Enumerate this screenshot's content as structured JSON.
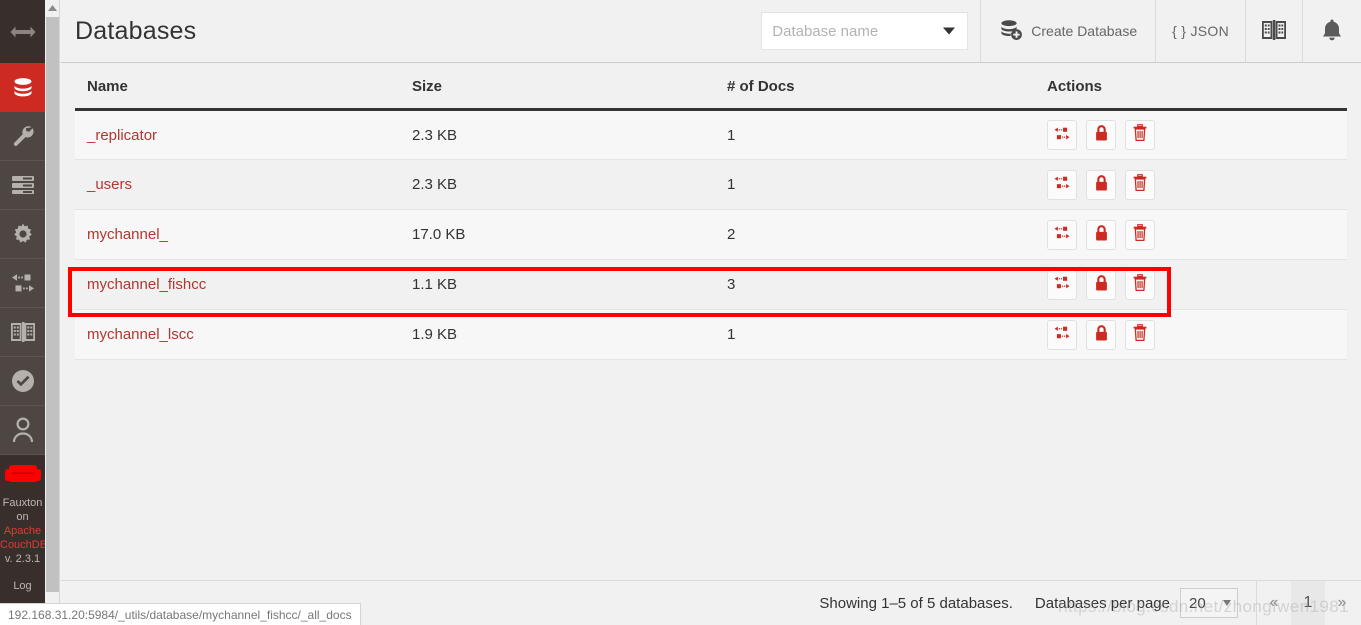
{
  "sidebar": {
    "items": [
      {
        "name": "toggle-sidebar",
        "icon": "double-arrow-icon",
        "active": false,
        "top": true
      },
      {
        "name": "databases",
        "icon": "database-icon",
        "active": true,
        "top": false
      },
      {
        "name": "setup",
        "icon": "wrench-icon",
        "active": false,
        "top": false
      },
      {
        "name": "active-tasks",
        "icon": "tasks-list-icon",
        "active": false,
        "top": false
      },
      {
        "name": "configuration",
        "icon": "gear-icon",
        "active": false,
        "top": false
      },
      {
        "name": "replication",
        "icon": "replication-arrows-icon",
        "active": false,
        "top": false
      },
      {
        "name": "documentation",
        "icon": "book-icon",
        "active": false,
        "top": false
      },
      {
        "name": "verify",
        "icon": "check-circle-icon",
        "active": false,
        "top": false
      },
      {
        "name": "user",
        "icon": "user-icon",
        "active": false,
        "top": false
      }
    ],
    "brand": {
      "logo": "couch-logo",
      "line1": "Fauxton",
      "line2": "on",
      "line3": "Apache",
      "line4": "CouchDB",
      "line5": "v. 2.3.1",
      "log_label": "Log"
    }
  },
  "header": {
    "title": "Databases",
    "db_select": {
      "placeholder": "Database name",
      "value": "",
      "caret_icon": "chevron-down-icon"
    },
    "create_button": {
      "label": "Create Database",
      "icon": "database-add-icon"
    },
    "json_button": {
      "label": "{ } JSON"
    },
    "docs_button": {
      "icon": "book-open-icon"
    },
    "notifications_button": {
      "icon": "bell-icon"
    }
  },
  "table": {
    "columns": [
      "Name",
      "Size",
      "# of Docs",
      "Actions"
    ],
    "action_icons": [
      "replicate-icon",
      "lock-icon",
      "trash-icon"
    ],
    "rows": [
      {
        "name": "_replicator",
        "size": "2.3 KB",
        "docs": "1",
        "highlighted": false
      },
      {
        "name": "_users",
        "size": "2.3 KB",
        "docs": "1",
        "highlighted": false
      },
      {
        "name": "mychannel_",
        "size": "17.0 KB",
        "docs": "2",
        "highlighted": false
      },
      {
        "name": "mychannel_fishcc",
        "size": "1.1 KB",
        "docs": "3",
        "highlighted": true
      },
      {
        "name": "mychannel_lscc",
        "size": "1.9 KB",
        "docs": "1",
        "highlighted": false
      }
    ]
  },
  "footer": {
    "showing": "Showing 1–5 of 5 databases.",
    "per_page_label": "Databases per page",
    "per_page_value": "20",
    "pager": {
      "prev": "«",
      "pages": [
        "1"
      ],
      "next": "»"
    }
  },
  "statusbar": {
    "url": "192.168.31.20:5984/_utils/database/mychannel_fishcc/_all_docs"
  },
  "watermark": {
    "text": "https://blog.csdn.net/zhongfwen1981"
  },
  "colors": {
    "accent_red": "#cd2b21",
    "sidebar_bg": "#4d4643",
    "sidebar_dark": "#382f2c",
    "link_red": "#b33630",
    "annotation_red": "#ff0000",
    "page_bg": "#f1f1f1"
  }
}
